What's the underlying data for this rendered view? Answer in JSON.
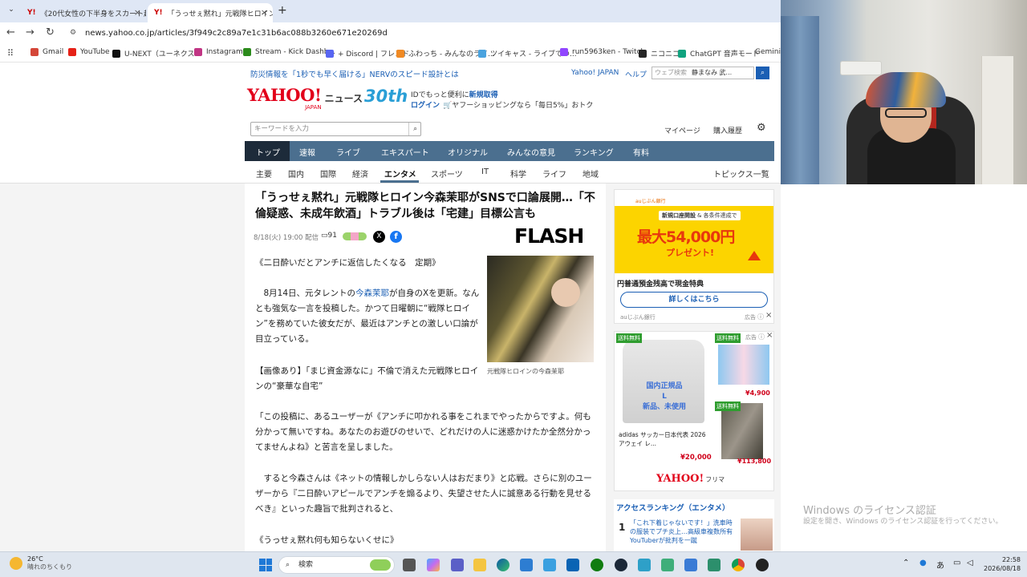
{
  "tabs": [
    {
      "label": "《20代女性の下半身をスカート越し",
      "active": false
    },
    {
      "label": "「うっせぇ黙れ」元戦隊ヒロイン今森",
      "active": true
    }
  ],
  "new_tab": "+",
  "url": "news.yahoo.co.jp/articles/3f949c2c89a7e1c31b6ac088b3260e671e20269d",
  "bookmarks": [
    {
      "label": "Gmail",
      "color": "#d44638"
    },
    {
      "label": "YouTube",
      "color": "#e62117"
    },
    {
      "label": "U-NEXT（ユーネクス...",
      "color": "#111111"
    },
    {
      "label": "Instagram",
      "color": "#c13584"
    },
    {
      "label": "Stream - Kick Dashb...",
      "color": "#53fc18"
    },
    {
      "label": "+ Discord | フレンド",
      "color": "#5865f2"
    },
    {
      "label": "ふわっち - みんなのライ...",
      "color": "#f08a24"
    },
    {
      "label": "ツイキャス - ライブでつ...",
      "color": "#4aa3df"
    },
    {
      "label": "run5963ken - Twitch",
      "color": "#9146ff"
    },
    {
      "label": "ニコニコ",
      "color": "#252525"
    },
    {
      "label": "ChatGPT 音声モード",
      "color": "#10a37f"
    },
    {
      "label": "Gemini",
      "color": "#4285f4"
    }
  ],
  "yahoo": {
    "top_notice": "防災情報を「1秒でも早く届ける」NERVのスピード設計とは",
    "yahoo_japan": "Yahoo! JAPAN",
    "help": "ヘルプ",
    "web_search_placeholder": "ウェブ検索",
    "web_search_value": "静まなみ 武...",
    "logo": "YAHOO!",
    "logo_sub": "JAPAN",
    "news_label": "ニュース",
    "anniv": "30th",
    "promo1_pre": "IDでもっと便利に",
    "promo1_link": "新規取得",
    "promo2_login": "ログイン",
    "promo2_text": "ヤフーショッピングなら「毎日5%」おトク",
    "keyword_placeholder": "キーワードを入力",
    "mypage": "マイページ",
    "purchase": "購入履歴",
    "nav1": [
      "トップ",
      "速報",
      "ライブ",
      "エキスパート",
      "オリジナル",
      "みんなの意見",
      "ランキング",
      "有料"
    ],
    "nav2": [
      "主要",
      "国内",
      "国際",
      "経済",
      "エンタメ",
      "スポーツ",
      "IT",
      "科学",
      "ライフ",
      "地域"
    ],
    "topics": "トピックス一覧"
  },
  "article": {
    "title": "「うっせぇ黙れ」元戦隊ヒロイン今森茉耶がSNSで口論展開…「不倫疑惑、未成年飲酒」トラブル後は「宅建」目標公言も",
    "date": "8/18(火) 19:00 配信",
    "comments": "91",
    "publisher": "FLASH",
    "caption": "元戦隊ヒロインの今森茉耶",
    "p1": "《二日酔いだとアンチに返信したくなる　定期》",
    "p2_pre": "8月14日、元タレントの",
    "p2_link": "今森茉耶",
    "p2_post": "が自身のXを更新。なんとも強気な一言を投稿した。かつて日曜朝に“戦隊ヒロイン”を務めていた彼女だが、最近はアンチとの激しい口論が目立っている。",
    "related": "【画像あり】「まじ資金源なに」不倫で消えた元戦隊ヒロインの“豪華な自宅”",
    "p3": "「この投稿に、あるユーザーが《アンチに叩かれる事をこれまでやったからですよ。何も分かって無いですね。あなたのお遊びのせいで、どれだけの人に迷惑かけたか全然分かってませんよね》と苦言を呈しました。",
    "p4": "すると今森さんは《ネットの情報しかしらない人はおだまり》と応戦。さらに別のユーザーから『二日酔いアピールでアンチを煽るより、失望させた人に誠意ある行動を見せるべき』といった趣旨で批判されると、",
    "p5": "《うっせぇ黙れ何も知らないくせに》"
  },
  "ad1": {
    "bank": "auじぶん銀行",
    "banner_top": "新規口座開設",
    "banner_sub": "& 各条件達成で",
    "banner_amount": "最大54,000円",
    "banner_present": "プレゼント!",
    "headline": "円普通預金残高で現金特典",
    "cta": "詳しくはこちら",
    "sponsor": "auじぶん銀行",
    "ad_label": "広告"
  },
  "ad2": {
    "badge": "送料無料",
    "product_label": "adidas サッカー日本代表 2026 アウェイ レ...",
    "price1": "¥20,000",
    "price2": "¥4,900",
    "price3": "¥113,800",
    "overlay": "国内正規品\nL\n新品、未使用",
    "brand": "YAHOO!",
    "brand_sub": "フリマ",
    "ad_label": "広告"
  },
  "ranking": {
    "title": "アクセスランキング（エンタメ）",
    "rank": "1",
    "item": "「これ下着じゃないです！」洗車時の服装でプチ炎上…高級車複数所有YouTuberが批判を一蹴"
  },
  "windows": {
    "license_title": "Windows のライセンス認証",
    "license_sub": "設定を開き、Windows のライセンス認証を行ってください。"
  },
  "taskbar": {
    "temp": "26°C",
    "weather": "晴れのちくもり",
    "search": "検索",
    "ime": "あ",
    "time": "22:58",
    "date": "2026/08/18"
  }
}
